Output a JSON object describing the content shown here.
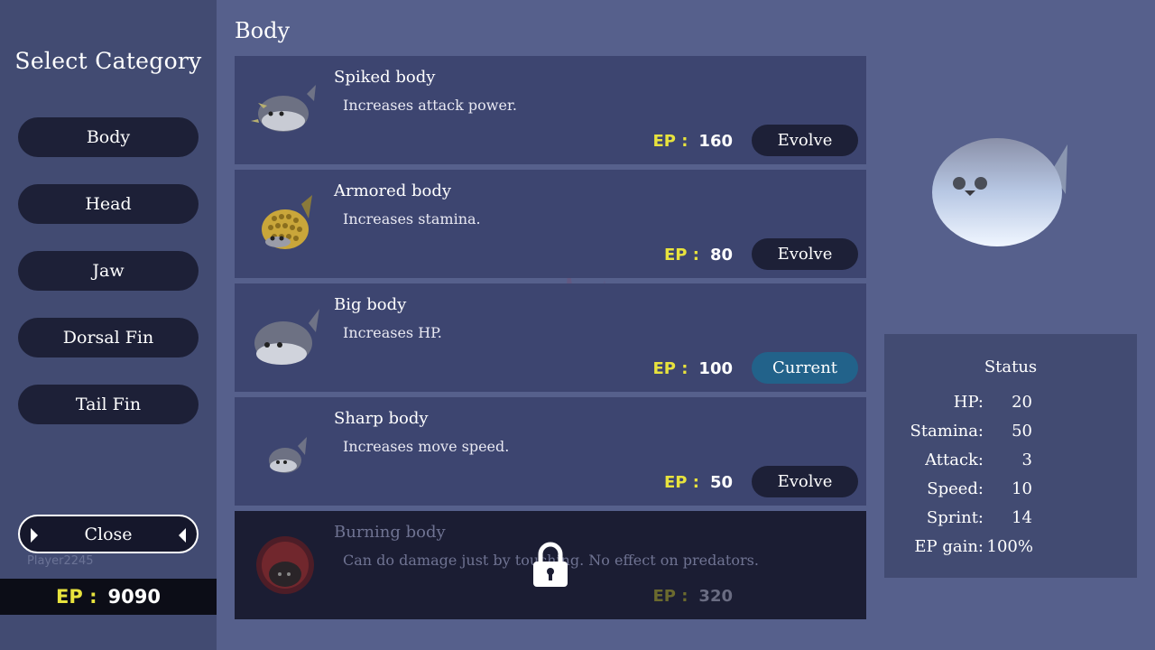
{
  "sidebar": {
    "title": "Select Category",
    "categories": [
      {
        "label": "Body"
      },
      {
        "label": "Head"
      },
      {
        "label": "Jaw"
      },
      {
        "label": "Dorsal Fin"
      },
      {
        "label": "Tail Fin"
      }
    ],
    "close_label": "Close",
    "player_name": "Player2245",
    "ep_label": "EP :",
    "ep_value": "9090"
  },
  "main": {
    "section_title": "Body",
    "items": [
      {
        "name": "Spiked body",
        "desc": "Increases attack power.",
        "ep_label": "EP :",
        "ep": "160",
        "action": "Evolve",
        "icon": "spiked-fish-icon"
      },
      {
        "name": "Armored body",
        "desc": "Increases stamina.",
        "ep_label": "EP :",
        "ep": "80",
        "action": "Evolve",
        "icon": "armored-fish-icon"
      },
      {
        "name": "Big body",
        "desc": "Increases HP.",
        "ep_label": "EP :",
        "ep": "100",
        "action": "Current",
        "icon": "big-fish-icon"
      },
      {
        "name": "Sharp body",
        "desc": "Increases move speed.",
        "ep_label": "EP :",
        "ep": "50",
        "action": "Evolve",
        "icon": "sharp-fish-icon"
      },
      {
        "name": "Burning body",
        "desc": "Can do damage just by touching. No effect on predators.",
        "ep_label": "EP :",
        "ep": "320",
        "locked": true,
        "icon": "burning-fish-icon"
      }
    ]
  },
  "status": {
    "title": "Status",
    "rows": [
      {
        "label": "HP:",
        "value": "20"
      },
      {
        "label": "Stamina:",
        "value": "50"
      },
      {
        "label": "Attack:",
        "value": "3"
      },
      {
        "label": "Speed:",
        "value": "10"
      },
      {
        "label": "Sprint:",
        "value": "14"
      },
      {
        "label": "EP gain:",
        "value": "100%"
      }
    ]
  },
  "colors": {
    "background": "#56608c",
    "panel": "#424b72",
    "item": "#3d4570",
    "button": "#1d2037",
    "current_button": "#22628a",
    "ep_yellow": "#e8e33d"
  }
}
